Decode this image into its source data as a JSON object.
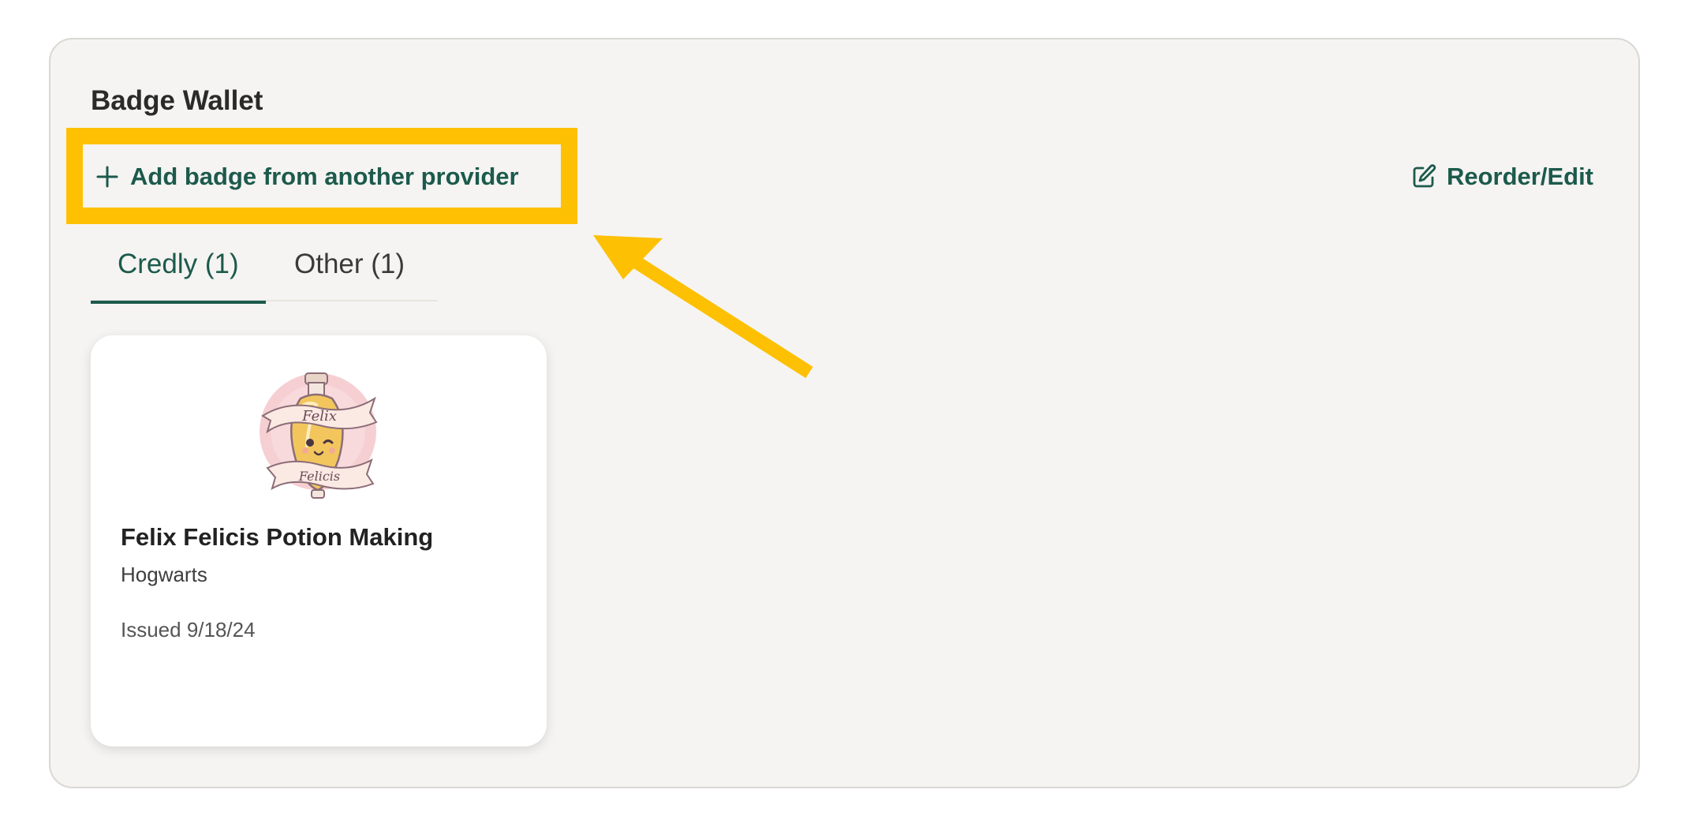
{
  "badge_wallet": {
    "title": "Badge Wallet",
    "add_badge_label": "Add badge from another provider",
    "reorder_label": "Reorder/Edit",
    "tabs": [
      {
        "label": "Credly (1)",
        "active": true
      },
      {
        "label": "Other (1)",
        "active": false
      }
    ],
    "badges": [
      {
        "name": "Felix Felicis Potion Making",
        "issuer": "Hogwarts",
        "issued": "Issued 9/18/24",
        "image_text_top": "Felix",
        "image_text_bottom": "Felicis"
      }
    ]
  },
  "colors": {
    "accent": "#1c5a4c",
    "highlight": "#fec002",
    "panel_bg": "#f5f4f2"
  },
  "icons": {
    "add": "plus-icon",
    "edit": "edit-icon"
  }
}
